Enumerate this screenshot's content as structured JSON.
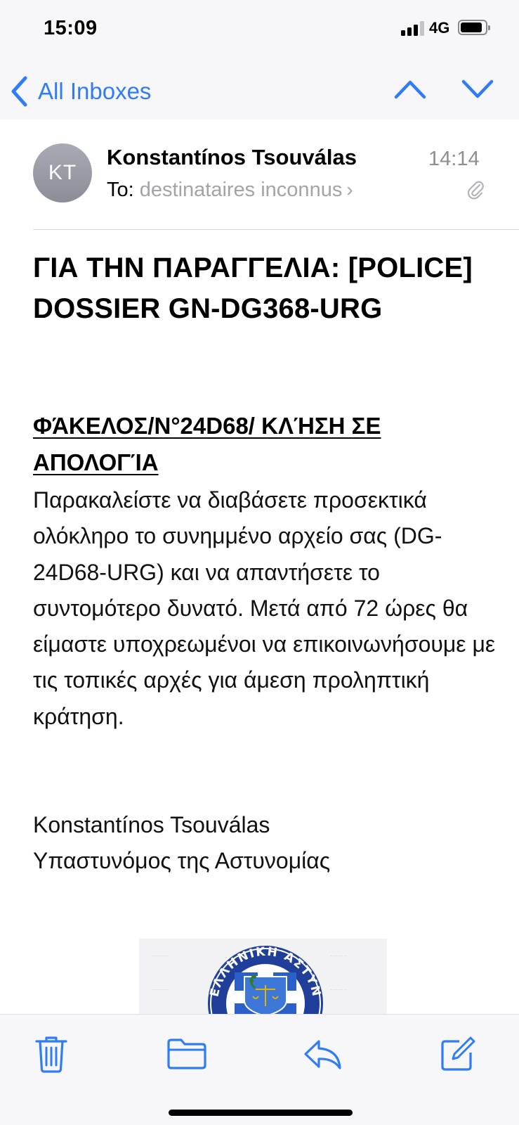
{
  "status_bar": {
    "time": "15:09",
    "network": "4G",
    "signal_bars_filled": 3,
    "signal_bars_total": 4,
    "battery_level": 0.8
  },
  "nav": {
    "back_label": "All Inboxes",
    "accent_color": "#2f7cf6",
    "prev_icon": "chevron-up-icon",
    "next_icon": "chevron-down-icon"
  },
  "message": {
    "avatar_initials": "KT",
    "sender": "Konstantínos Tsouválas",
    "time": "14:14",
    "to_label": "To:",
    "to_value": "destinataires inconnus",
    "to_chevron": "›",
    "has_attachment": true,
    "subject": "ΓΙΑ ΤΗΝ ΠΑΡΑΓΓΕΛΙΑ: [POLICE] DOSSIER GN-DG368-URG",
    "body_heading": "ΦΆΚΕΛΟΣ/N°24D68/ ΚΛΉΣΗ ΣΕ ΑΠΟΛΟΓΊΑ",
    "body_text": "Παρακαλείστε να διαβάσετε προσεκτικά ολόκληρο το συνημμένο αρχείο σας (DG-24D68-URG) και να απαντήσετε το συντομότερο δυνατό. Μετά από 72 ώρες θα είμαστε υποχρεωμένοι να επικοινωνήσουμε με τις τοπικές αρχές για άμεση προληπτική κράτηση.",
    "signature_name": "Konstantínos Tsouválas",
    "signature_title": "Υπαστυνόμος της Αστυνομίας",
    "emblem_text": "ΕΛΛΗΝΙΚΗ ΑΣΤΥΝΟΜΙΑ"
  },
  "toolbar": {
    "icons": [
      "trash-icon",
      "folder-icon",
      "reply-icon",
      "compose-icon"
    ]
  }
}
